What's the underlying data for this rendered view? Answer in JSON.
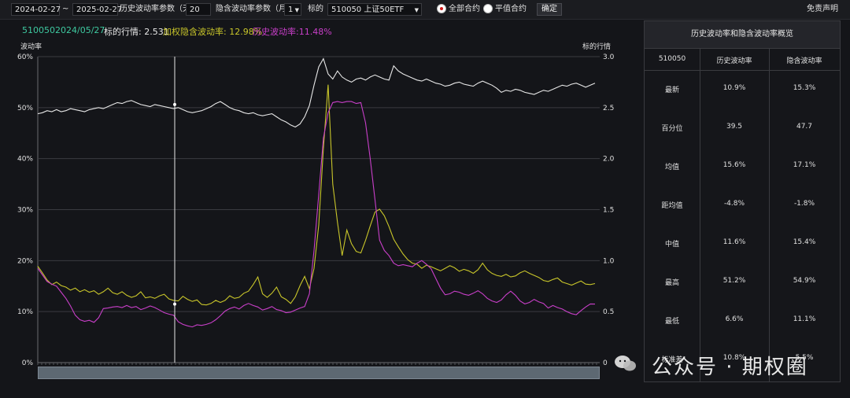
{
  "toolbar": {
    "start_date": "2024-02-27",
    "date_separator": "~",
    "end_date": "2025-02-27",
    "hv_param_label": "历史波动率参数（天）",
    "hv_param_value": "20",
    "iv_param_label": "隐含波动率参数（月）",
    "iv_param_value": "1",
    "underlying_label": "标的",
    "underlying_value": "510050 上证50ETF",
    "radio_all": "全部合约",
    "radio_atm": "平值合约",
    "confirm": "确定",
    "disclaimer": "免责声明"
  },
  "info": {
    "code": "510050",
    "date": "2024/05/27",
    "price_label": "标的行情: 2.531",
    "iv_label": "加权隐含波动率: 12.98%",
    "hv_label": "历史波动率:11.48%"
  },
  "axes": {
    "left_title": "波动率",
    "right_title": "标的行情",
    "left_ticks": [
      "60%",
      "50%",
      "40%",
      "30%",
      "20%",
      "10%",
      "0%"
    ],
    "right_ticks": [
      "3.0",
      "2.5",
      "2.0",
      "1.5",
      "1.0",
      "0.5",
      "0"
    ]
  },
  "colors": {
    "price": "#e8e8e8",
    "iv": "#c9c62a",
    "hv": "#c93fc9",
    "code_text": "#3ec9a0"
  },
  "chart_data": {
    "type": "line",
    "xlabel": "",
    "ylabel": "波动率",
    "y2label": "标的行情",
    "ylim": [
      0,
      60
    ],
    "y2lim": [
      0,
      3.0
    ],
    "x_range": [
      "2024-02-27",
      "2025-02-27"
    ],
    "cursor_x": "2024/05/27",
    "grid": true,
    "series": [
      {
        "name": "标的行情",
        "axis": "right",
        "color": "#e8e8e8",
        "values": [
          2.44,
          2.45,
          2.47,
          2.46,
          2.48,
          2.46,
          2.47,
          2.49,
          2.48,
          2.47,
          2.46,
          2.48,
          2.49,
          2.5,
          2.49,
          2.51,
          2.53,
          2.55,
          2.54,
          2.56,
          2.57,
          2.55,
          2.53,
          2.52,
          2.51,
          2.53,
          2.52,
          2.51,
          2.5,
          2.49,
          2.5,
          2.48,
          2.46,
          2.45,
          2.46,
          2.47,
          2.49,
          2.51,
          2.54,
          2.56,
          2.53,
          2.5,
          2.48,
          2.47,
          2.45,
          2.44,
          2.45,
          2.43,
          2.42,
          2.43,
          2.44,
          2.41,
          2.38,
          2.36,
          2.33,
          2.31,
          2.34,
          2.41,
          2.52,
          2.72,
          2.9,
          2.98,
          2.83,
          2.78,
          2.86,
          2.8,
          2.77,
          2.75,
          2.78,
          2.79,
          2.77,
          2.8,
          2.82,
          2.8,
          2.78,
          2.77,
          2.91,
          2.86,
          2.83,
          2.81,
          2.79,
          2.77,
          2.76,
          2.78,
          2.76,
          2.74,
          2.73,
          2.71,
          2.72,
          2.74,
          2.75,
          2.73,
          2.72,
          2.71,
          2.74,
          2.76,
          2.74,
          2.72,
          2.69,
          2.65,
          2.67,
          2.66,
          2.68,
          2.67,
          2.65,
          2.64,
          2.63,
          2.65,
          2.67,
          2.66,
          2.68,
          2.7,
          2.72,
          2.71,
          2.73,
          2.74,
          2.72,
          2.7,
          2.72,
          2.74
        ]
      },
      {
        "name": "隐含波动率",
        "axis": "left",
        "color": "#c9c62a",
        "values": [
          18.9,
          17.6,
          16.2,
          15.3,
          15.8,
          15.1,
          14.8,
          14.2,
          14.6,
          13.9,
          14.3,
          13.8,
          14.1,
          13.4,
          13.9,
          14.6,
          13.7,
          13.4,
          13.9,
          13.2,
          12.8,
          13.1,
          13.9,
          12.7,
          12.9,
          12.6,
          13.1,
          13.4,
          12.5,
          12.2,
          12.1,
          13.0,
          12.4,
          12.0,
          12.3,
          11.4,
          11.3,
          11.6,
          12.2,
          11.8,
          12.2,
          13.1,
          12.6,
          12.8,
          13.6,
          14.0,
          15.3,
          16.8,
          13.5,
          12.8,
          13.6,
          14.8,
          12.9,
          12.4,
          11.6,
          12.9,
          15.1,
          16.9,
          14.5,
          18.5,
          27.0,
          42.0,
          54.5,
          35.0,
          27.5,
          21.0,
          26.0,
          23.3,
          21.8,
          21.5,
          24.0,
          26.8,
          29.5,
          30.1,
          28.8,
          26.7,
          24.2,
          22.7,
          21.3,
          20.2,
          19.5,
          19.3,
          18.5,
          19.1,
          18.8,
          18.4,
          18.0,
          18.5,
          19.0,
          18.6,
          17.9,
          18.3,
          18.0,
          17.5,
          18.2,
          19.5,
          18.2,
          17.5,
          17.1,
          16.9,
          17.3,
          16.8,
          17.0,
          17.6,
          18.0,
          17.5,
          17.1,
          16.7,
          16.1,
          15.9,
          16.3,
          16.6,
          15.8,
          15.5,
          15.2,
          15.6,
          16.0,
          15.4,
          15.3,
          15.5
        ]
      },
      {
        "name": "历史波动率",
        "axis": "left",
        "color": "#c93fc9",
        "values": [
          18.5,
          17.2,
          15.9,
          15.4,
          15.0,
          13.8,
          12.6,
          11.1,
          9.3,
          8.4,
          8.1,
          8.3,
          7.9,
          8.8,
          10.6,
          10.7,
          10.9,
          11.0,
          10.8,
          11.2,
          10.8,
          11.0,
          10.4,
          10.7,
          11.1,
          10.8,
          10.3,
          9.8,
          9.5,
          9.3,
          8.0,
          7.5,
          7.2,
          7.0,
          7.4,
          7.3,
          7.5,
          7.8,
          8.4,
          9.2,
          10.1,
          10.6,
          10.9,
          10.5,
          11.2,
          11.6,
          11.2,
          10.9,
          10.3,
          10.6,
          11.0,
          10.4,
          10.2,
          9.8,
          9.9,
          10.3,
          10.7,
          11.0,
          13.5,
          22.0,
          33.0,
          44.0,
          49.0,
          51.0,
          51.2,
          51.0,
          51.2,
          51.2,
          50.8,
          51.0,
          47.0,
          40.0,
          32.0,
          24.0,
          22.0,
          21.0,
          19.5,
          19.0,
          19.2,
          19.0,
          18.8,
          19.5,
          20.0,
          19.3,
          18.4,
          16.5,
          14.6,
          13.3,
          13.5,
          14.0,
          13.8,
          13.4,
          13.2,
          13.6,
          14.1,
          13.5,
          12.6,
          12.1,
          11.8,
          12.3,
          13.3,
          14.0,
          13.2,
          12.1,
          11.5,
          11.8,
          12.4,
          11.9,
          11.6,
          10.7,
          11.2,
          10.8,
          10.5,
          10.0,
          9.6,
          9.4,
          10.2,
          10.9,
          11.5,
          11.48
        ]
      }
    ]
  },
  "summary": {
    "title": "历史波动率和隐含波动率概览",
    "headers": [
      "510050",
      "历史波动率",
      "隐含波动率"
    ],
    "rows": [
      {
        "label": "最新",
        "hv": "10.9%",
        "iv": "15.3%"
      },
      {
        "label": "百分位",
        "hv": "39.5",
        "iv": "47.7"
      },
      {
        "label": "均值",
        "hv": "15.6%",
        "iv": "17.1%"
      },
      {
        "label": "距均值",
        "hv": "-4.8%",
        "iv": "-1.8%"
      },
      {
        "label": "中值",
        "hv": "11.6%",
        "iv": "15.4%"
      },
      {
        "label": "最高",
        "hv": "51.2%",
        "iv": "54.9%"
      },
      {
        "label": "最低",
        "hv": "6.6%",
        "iv": "11.1%"
      },
      {
        "label": "标准差",
        "hv": "10.8%",
        "iv": "5.5%"
      }
    ]
  },
  "watermark": "公众号 · 期权圈"
}
